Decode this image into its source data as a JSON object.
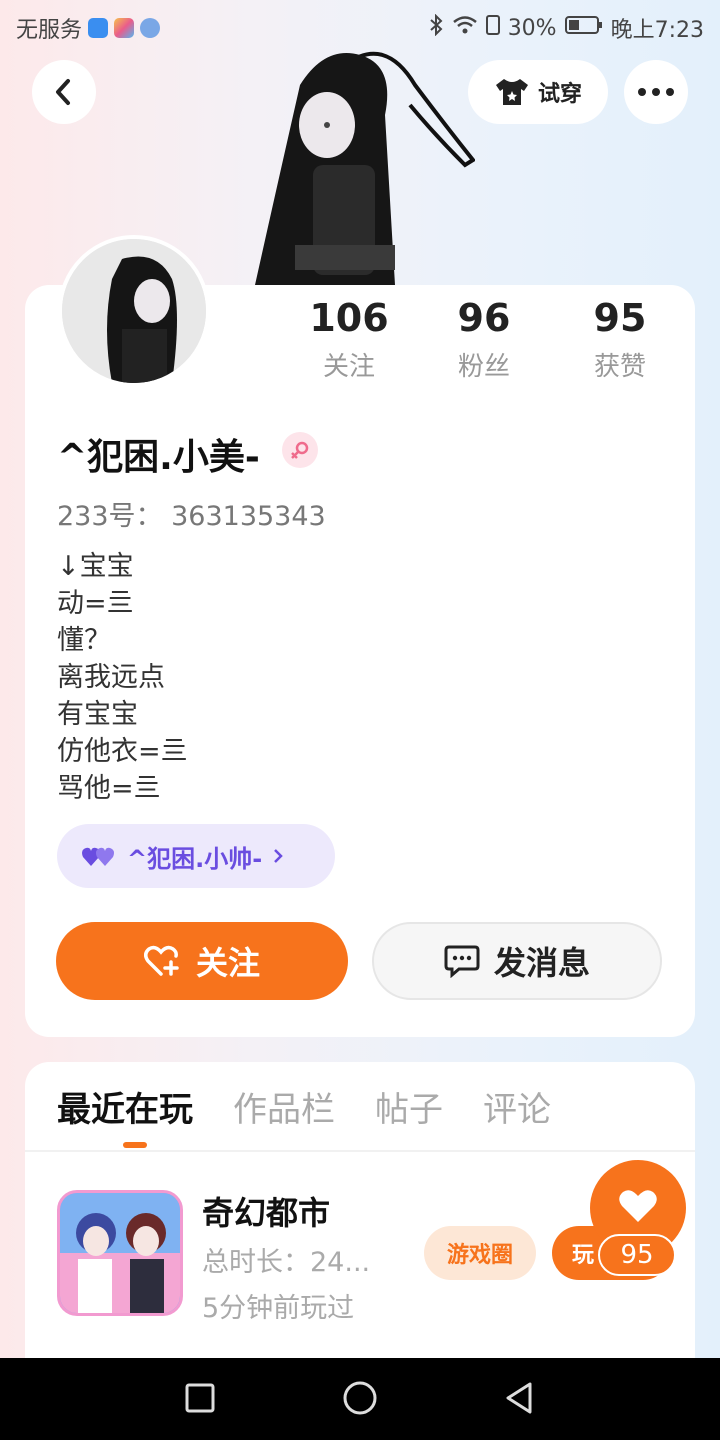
{
  "status_bar": {
    "carrier": "无服务",
    "battery": "30%",
    "time": "晚上7:23"
  },
  "header": {
    "try_on_label": "试穿"
  },
  "stats": [
    {
      "value": "106",
      "label": "关注"
    },
    {
      "value": "96",
      "label": "粉丝"
    },
    {
      "value": "95",
      "label": "获赞"
    }
  ],
  "profile": {
    "name": "^犯困.小美-",
    "uid": "233号：  363135343",
    "bio": [
      "↓宝宝",
      "动=亖",
      "懂？",
      "离我远点",
      "有宝宝",
      "仿他衣=亖",
      "骂他=亖"
    ],
    "couple_name": "^犯困.小帅-"
  },
  "actions": {
    "follow": "关注",
    "message": "发消息"
  },
  "tabs": [
    "最近在玩",
    "作品栏",
    "帖子",
    "评论"
  ],
  "game": {
    "title": "奇幻都市",
    "duration": "总时长：24...",
    "last_played": "5分钟前玩过",
    "circle_chip": "游戏圈",
    "play_chip": "玩"
  },
  "fab": {
    "count": "95"
  },
  "colors": {
    "accent": "#f7731c",
    "couple": "#6a4de0"
  }
}
